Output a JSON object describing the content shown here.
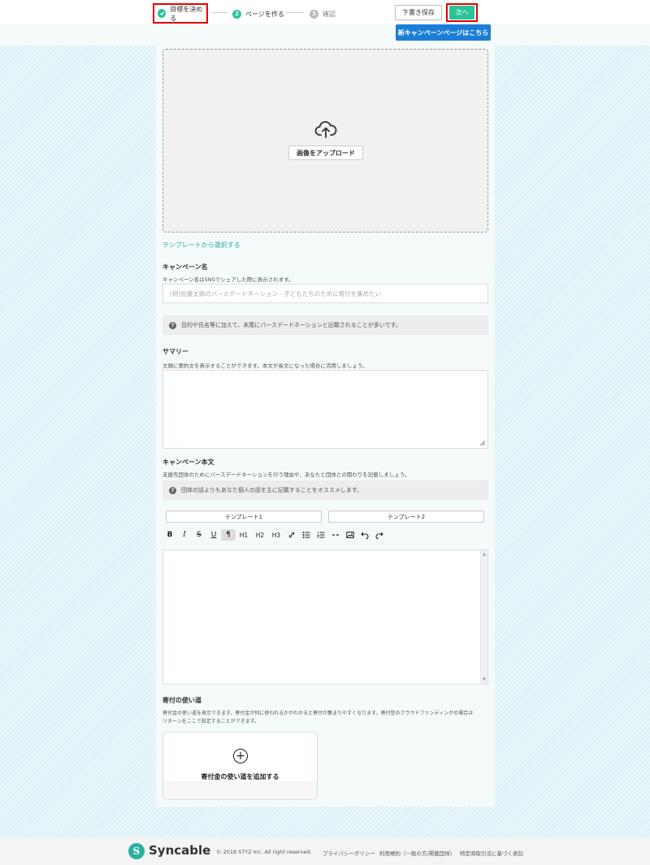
{
  "header": {
    "steps": [
      {
        "num": "",
        "label": "目標を決める"
      },
      {
        "num": "2",
        "label": "ページを作る"
      },
      {
        "num": "3",
        "label": "確認"
      }
    ],
    "draft_label": "下書き保存",
    "next_label": "次へ",
    "new_page_label": "新キャンペーンページはこちら"
  },
  "upload": {
    "button_label": "画像をアップロード",
    "icon": "cloud-upload-icon"
  },
  "template_link": "テンプレートから選択する",
  "campaign_name": {
    "label": "キャンペーン名",
    "description": "キャンペーン名はSNSでシェアした際に表示されます。",
    "placeholder": "(例)佐藤太郎のバースデードネーション - 子どもたちのために寄付を集めたい",
    "hint": "目的や氏名等に加えて、末尾にバースデードネーションと記載されることが多いです。"
  },
  "summary": {
    "label": "サマリー",
    "description": "文頭に要約文を表示することができます。本文が長文になった場合に活用しましょう。"
  },
  "body": {
    "label": "キャンペーン本文",
    "description": "支援先団体のためにバースデードネーションを行う理由や、あなたと団体との関わりを記載しましょう。",
    "hint": "団体の話よりもあなた個人の話を主に記載することをオススメします。",
    "template1": "テンプレート1",
    "template2": "テンプレート2",
    "toolbar": [
      "B",
      "I",
      "S",
      "U",
      "¶",
      "H1",
      "H2",
      "H3"
    ]
  },
  "usage": {
    "label": "寄付の使い道",
    "description1": "寄付金の使い道を表示できます。寄付金が何に使われるかがわかると寄付が集まりやすくなります。寄付型のクラウドファンディングの場合は",
    "description2": "リターンをここで設定することができます。",
    "add_label": "寄付金の使い道を追加する"
  },
  "footer": {
    "logo_letter": "S",
    "logo_text": "Syncable",
    "copyright": "© 2018 STYZ Inc. All right reserved.",
    "links": [
      "プライバシーポリシー",
      "利用規約（一般の方/掲載団体）",
      "特定商取引法に基づく表記"
    ]
  }
}
